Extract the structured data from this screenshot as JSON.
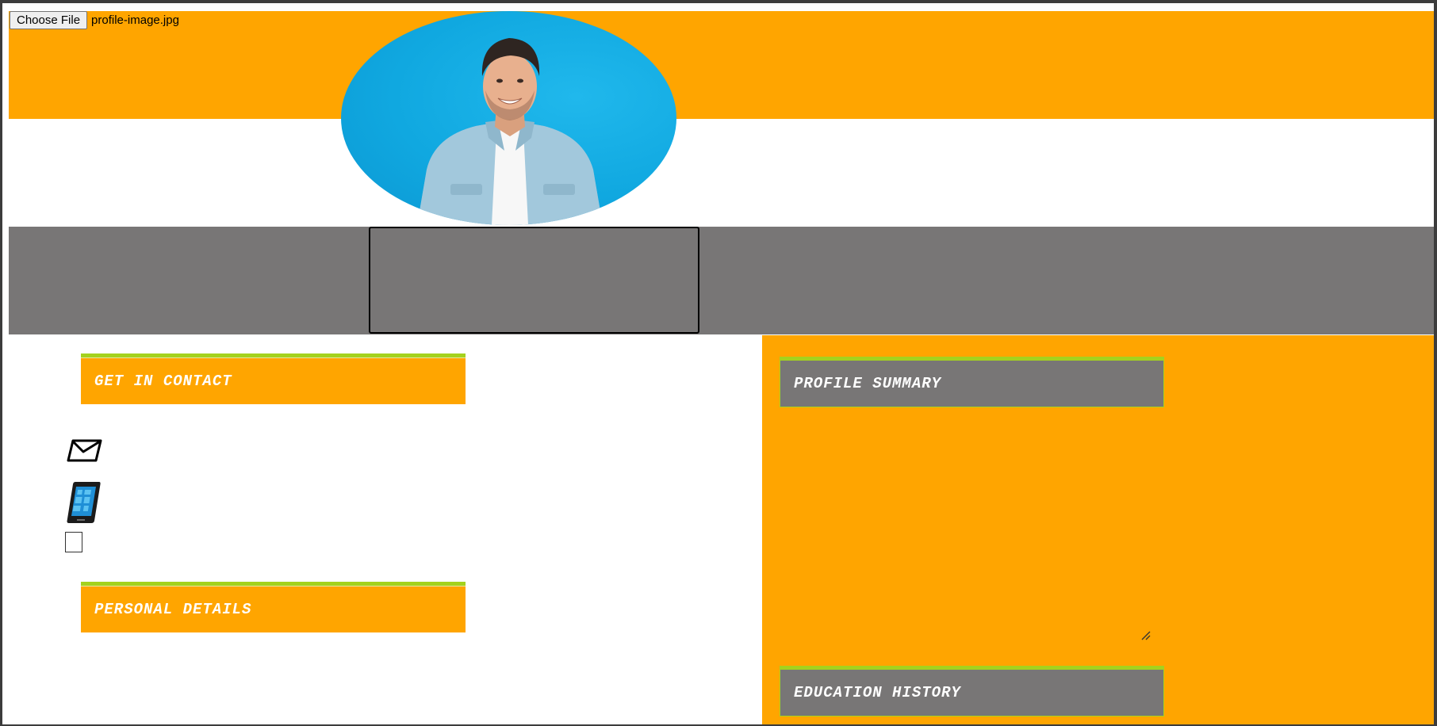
{
  "upload": {
    "button_label": "Choose File",
    "file_name": "profile-image.jpg"
  },
  "sections": {
    "contact_heading": "GET IN CONTACT",
    "personal_heading": "PERSONAL DETAILS",
    "summary_heading": "PROFILE SUMMARY",
    "education_heading": "EDUCATION HISTORY"
  },
  "icons": {
    "email": "envelope-icon",
    "phone": "mobile-phone-icon"
  },
  "colors": {
    "accent_orange": "#ffa500",
    "band_gray": "#787676",
    "heading_border_green": "#a4d21e",
    "photo_background_blue": "#10a8e0"
  }
}
